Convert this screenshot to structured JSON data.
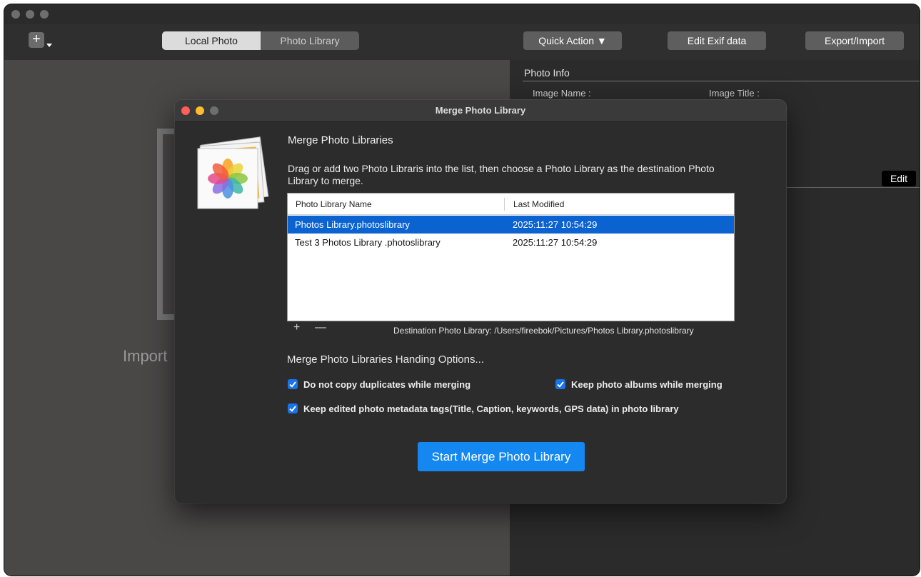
{
  "toolbar": {
    "add_symbol": "+",
    "tabs": [
      {
        "label": "Local Photo",
        "active": true
      },
      {
        "label": "Photo Library",
        "active": false
      }
    ],
    "quick_action_label": "Quick Action ▼",
    "edit_exif_label": "Edit Exif data",
    "export_import_label": "Export/Import"
  },
  "left_pane": {
    "import_text": "Import"
  },
  "photo_info": {
    "title": "Photo Info",
    "image_name_label": "Image Name :",
    "image_title_label": "Image Title :",
    "edit_label": "Edit"
  },
  "dialog": {
    "title": "Merge Photo Library",
    "heading": "Merge Photo Libraries",
    "description": "Drag or add two Photo Libraris into the list, then choose a Photo Library as the destination Photo Library to merge.",
    "table": {
      "columns": [
        "Photo Library Name",
        "Last Modified"
      ],
      "rows": [
        {
          "name": "Photos Library.photoslibrary",
          "modified": "2025:11:27 10:54:29",
          "selected": true
        },
        {
          "name": "Test 3 Photos Library .photoslibrary",
          "modified": "2025:11:27 10:54:29",
          "selected": false
        }
      ]
    },
    "add_symbol": "+",
    "remove_symbol": "—",
    "destination": "Destination Photo Library: /Users/fireebok/Pictures/Photos Library.photoslibrary",
    "options_heading": "Merge Photo Libraries Handing Options...",
    "options": {
      "no_duplicates": {
        "label": "Do not copy duplicates while merging",
        "checked": true
      },
      "keep_albums": {
        "label": "Keep photo albums while merging",
        "checked": true
      },
      "keep_metadata": {
        "label": "Keep edited photo metadata tags(Title, Caption, keywords, GPS data) in photo library",
        "checked": true
      }
    },
    "start_button_label": "Start Merge Photo Library"
  },
  "colors": {
    "accent": "#1487f0",
    "selection": "#0a63d1",
    "close": "#ff5f57",
    "minimize": "#febc2e",
    "zoom_inactive": "#6e6e6e"
  }
}
